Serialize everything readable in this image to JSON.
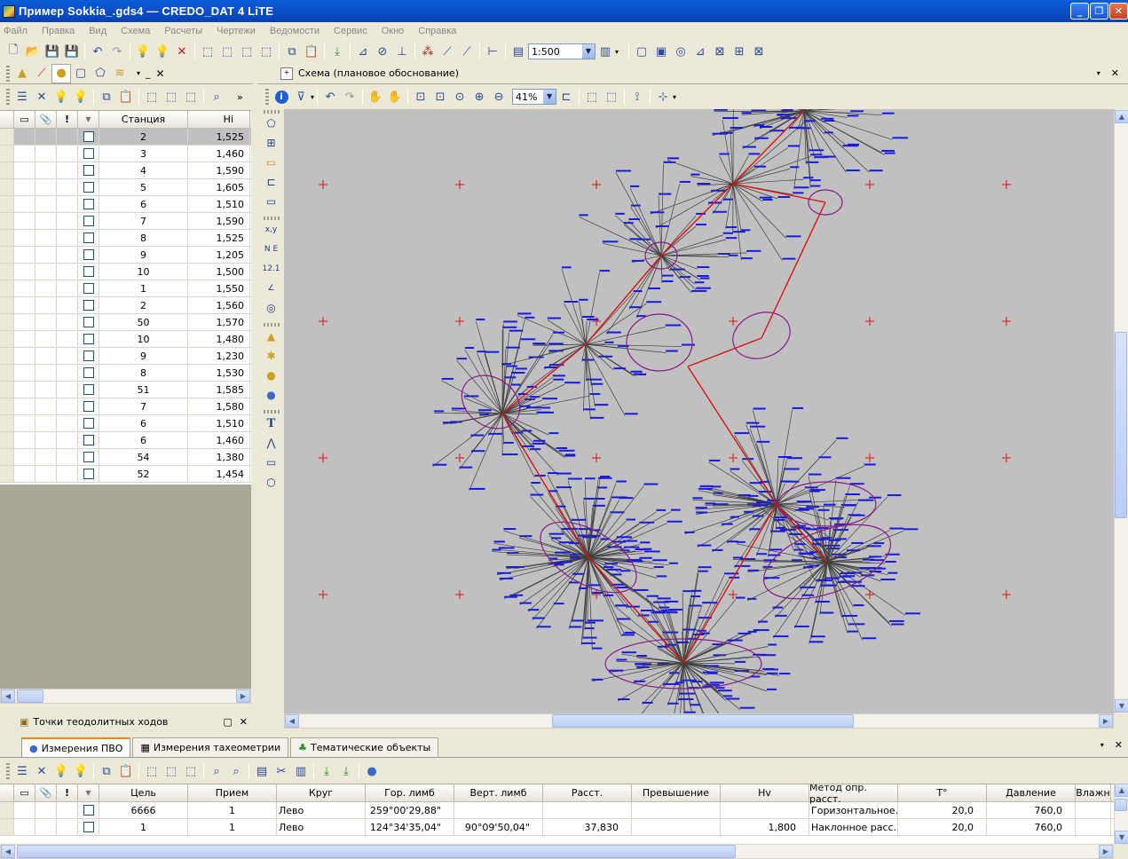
{
  "window": {
    "title": "Пример Sokkia_.gds4 — CREDO_DAT 4 LiTE"
  },
  "menu": [
    "Файл",
    "Правка",
    "Вид",
    "Схема",
    "Расчеты",
    "Чертежи",
    "Ведомости",
    "Сервис",
    "Окно",
    "Справка"
  ],
  "toolbar": {
    "scale": "1:500"
  },
  "schema_panel": {
    "title": "Схема (плановое обоснование)",
    "zoom": "41%"
  },
  "stations": {
    "columns": [
      "Станция",
      "Hi"
    ],
    "rows": [
      {
        "station": "2",
        "hi": "1,525"
      },
      {
        "station": "3",
        "hi": "1,460"
      },
      {
        "station": "4",
        "hi": "1,590"
      },
      {
        "station": "5",
        "hi": "1,605"
      },
      {
        "station": "6",
        "hi": "1,510"
      },
      {
        "station": "7",
        "hi": "1,590"
      },
      {
        "station": "8",
        "hi": "1,525"
      },
      {
        "station": "9",
        "hi": "1,205"
      },
      {
        "station": "10",
        "hi": "1,500"
      },
      {
        "station": "1",
        "hi": "1,550"
      },
      {
        "station": "2",
        "hi": "1,560"
      },
      {
        "station": "50",
        "hi": "1,570"
      },
      {
        "station": "10",
        "hi": "1,480"
      },
      {
        "station": "9",
        "hi": "1,230"
      },
      {
        "station": "8",
        "hi": "1,530"
      },
      {
        "station": "51",
        "hi": "1,585"
      },
      {
        "station": "7",
        "hi": "1,580"
      },
      {
        "station": "6",
        "hi": "1,510"
      },
      {
        "station": "6",
        "hi": "1,460"
      },
      {
        "station": "54",
        "hi": "1,380"
      },
      {
        "station": "52",
        "hi": "1,454"
      }
    ]
  },
  "points_panel": {
    "title": "Точки теодолитных ходов"
  },
  "bottom_tabs": [
    "Измерения ПВО",
    "Измерения тахеометрии",
    "Тематические объекты"
  ],
  "measurements": {
    "columns": [
      "Цель",
      "Прием",
      "Круг",
      "Гор. лимб",
      "Верт. лимб",
      "Расст.",
      "Превышение",
      "Hv",
      "Метод опр. расст.",
      "T°",
      "Давление",
      "Влажн"
    ],
    "rows": [
      [
        "6666",
        "1",
        "Лево",
        "259°00'29,88\"",
        "",
        "",
        "",
        "",
        "Горизонтальное...",
        "20,0",
        "760,0",
        ""
      ],
      [
        "1",
        "1",
        "Лево",
        "124°34'35,04\"",
        "90°09'50,04\"",
        "37,830",
        "",
        "1,800",
        "Наклонное расс...",
        "20,0",
        "760,0",
        ""
      ]
    ]
  },
  "colors": {
    "titlebar": "#0a5fd8",
    "canvas": "#c0c0c0",
    "traverse": "#dd1111",
    "ellipse": "#8b1a8b",
    "labels": "#1a1adf"
  }
}
